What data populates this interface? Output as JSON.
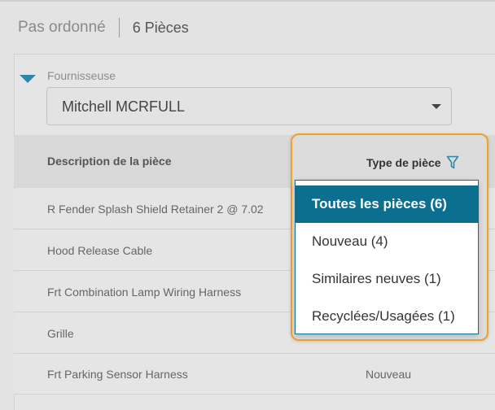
{
  "header": {
    "status": "Pas ordonné",
    "count_label": "6 Pièces"
  },
  "supplier": {
    "label": "Fournisseuse",
    "value": "Mitchell MCRFULL"
  },
  "table": {
    "columns": [
      "Description de la pièce",
      "Type de pièce"
    ],
    "rows": [
      {
        "description": "R Fender Splash Shield Retainer 2 @ 7.02",
        "type": ""
      },
      {
        "description": "Hood Release Cable",
        "type": ""
      },
      {
        "description": "Frt Combination Lamp Wiring Harness",
        "type": ""
      },
      {
        "description": "Grille",
        "type": ""
      },
      {
        "description": "Frt Parking Sensor Harness",
        "type": "Nouveau"
      }
    ]
  },
  "filter_menu": {
    "options": [
      {
        "label": "Toutes les pièces (6)",
        "selected": true
      },
      {
        "label": "Nouveau (4)",
        "selected": false
      },
      {
        "label": "Similaires neuves (1)",
        "selected": false
      },
      {
        "label": "Recyclées/Usagées (1)",
        "selected": false
      }
    ]
  },
  "colors": {
    "accent": "#0d6f8f",
    "highlight_border": "#f0a12c",
    "filter_icon": "#2e86a8"
  }
}
